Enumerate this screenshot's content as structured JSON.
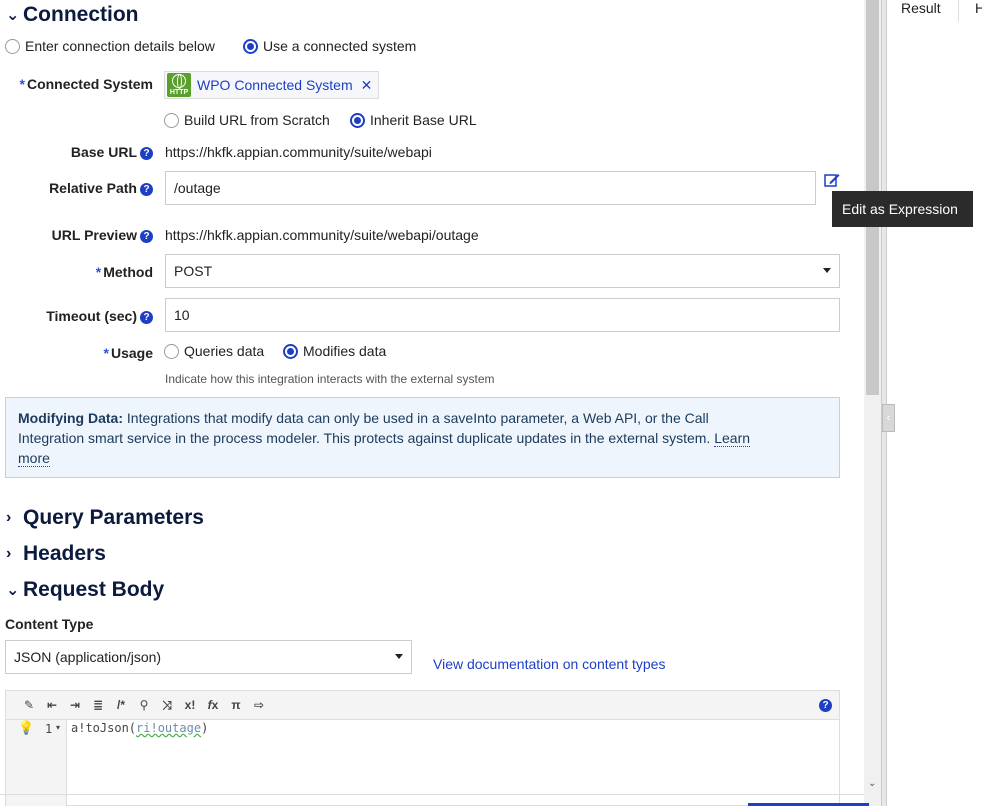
{
  "connection": {
    "heading": "Connection",
    "radio_enter": "Enter connection details below",
    "radio_use": "Use a connected system",
    "connected_system_label": "Connected System",
    "connected_system_icon_text": "HTTP",
    "connected_system_value": "WPO Connected System",
    "url_radio_build": "Build URL from Scratch",
    "url_radio_inherit": "Inherit Base URL",
    "base_url_label": "Base URL",
    "base_url_value": "https://hkfk.appian.community/suite/webapi",
    "relative_path_label": "Relative Path",
    "relative_path_value": "/outage",
    "url_preview_label": "URL Preview",
    "url_preview_value": "https://hkfk.appian.community/suite/webapi/outage",
    "method_label": "Method",
    "method_value": "POST",
    "timeout_label": "Timeout (sec)",
    "timeout_value": "10",
    "usage_label": "Usage",
    "usage_queries": "Queries data",
    "usage_modifies": "Modifies data",
    "usage_hint": "Indicate how this integration interacts with the external system",
    "info_bold": "Modifying Data:",
    "info_text_1": " Integrations that modify data can only be used in a saveInto parameter, a Web API, or the Call",
    "info_text_2": "Integration smart service in the process modeler. This protects against duplicate updates in the external system. ",
    "info_link_1": "Learn",
    "info_link_2": "more"
  },
  "tooltip": "Edit as Expression",
  "sections": {
    "query_parameters": "Query Parameters",
    "headers": "Headers",
    "request_body": "Request Body"
  },
  "request_body": {
    "content_type_label": "Content Type",
    "content_type_value": "JSON (application/json)",
    "doc_link": "View documentation on content types",
    "line_number": "1",
    "code_fn": "a!toJson(",
    "code_arg": "ri!outage",
    "code_close": ")"
  },
  "right_panel": {
    "tab_result": "Result",
    "tab_partial": "H"
  },
  "colors": {
    "accent": "#1d3fc6",
    "heading": "#0b1a3d",
    "info_bg": "#eef5fc",
    "chip_icon_green": "#5aa02c",
    "tooltip_bg": "#2b2b2b"
  }
}
